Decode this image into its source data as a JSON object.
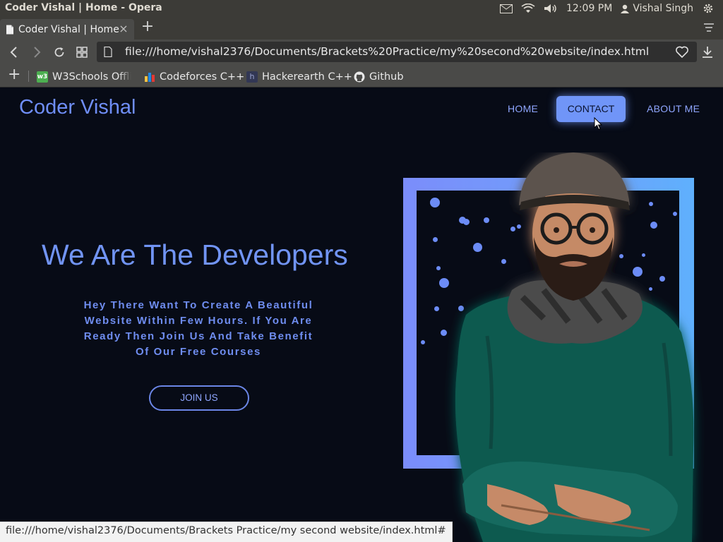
{
  "os": {
    "window_title": "Coder Vishal | Home - Opera",
    "clock": "12:09 PM",
    "user": "Vishal Singh",
    "tray_icons": [
      "mail-icon",
      "wifi-icon",
      "volume-icon",
      "user-icon",
      "settings-gear-icon"
    ]
  },
  "browser": {
    "tab_title": "Coder Vishal | Home",
    "new_tab_label": "+",
    "tab_close_label": "×",
    "url": "file:///home/vishal2376/Documents/Brackets%20Practice/my%20second%20website/index.html",
    "bookmarks": [
      {
        "label": "W3Schools Offli",
        "icon": "w3schools-icon",
        "color": "#4caf50"
      },
      {
        "label": "Codeforces C++",
        "icon": "codeforces-icon",
        "color": "#f6c343"
      },
      {
        "label": "Hackerearth C++",
        "icon": "hackerearth-icon",
        "color": "#323754"
      },
      {
        "label": "Github",
        "icon": "github-icon",
        "color": "#ffffff"
      }
    ],
    "status_url": "file:///home/vishal2376/Documents/Brackets Practice/my second website/index.html#"
  },
  "page": {
    "logo": "Coder Vishal",
    "nav": {
      "home": "HOME",
      "contact": "CONTACT",
      "about": "ABOUT ME"
    },
    "hero": {
      "title": "We Are The Developers",
      "text": "Hey There Want To Create A Beautiful Website Within Few Hours. If You Are Ready Then Join Us And Take Benefit Of Our Free Courses",
      "button": "JOIN US"
    },
    "colors": {
      "background": "#070b16",
      "accent": "#7194f4",
      "contact_button": "#7095f8"
    }
  }
}
